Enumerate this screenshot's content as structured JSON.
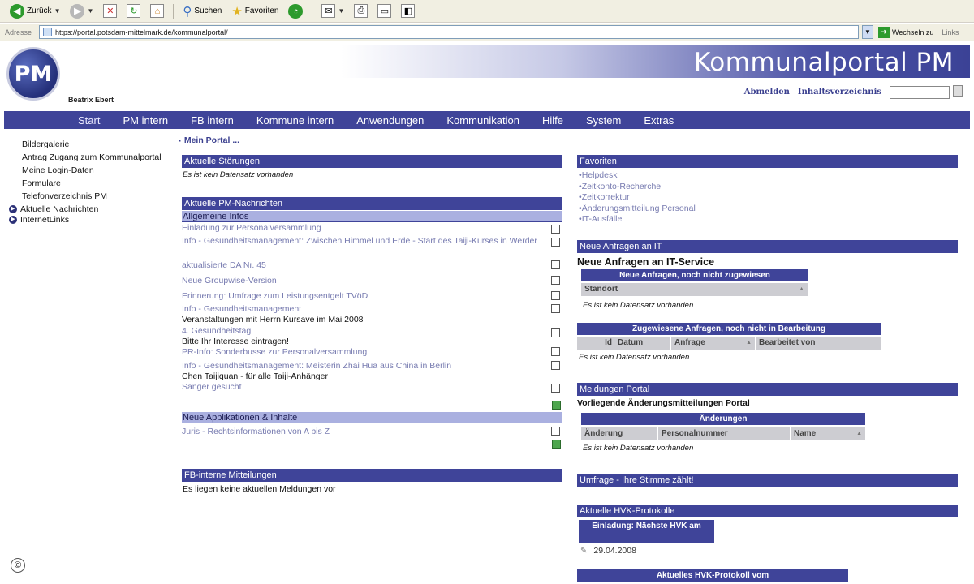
{
  "browser": {
    "back_label": "Zurück",
    "search_label": "Suchen",
    "favorites_label": "Favoriten",
    "address_label": "Adresse",
    "url": "https://portal.potsdam-mittelmark.de/kommunalportal/",
    "go_label": "Wechseln zu",
    "links_label": "Links"
  },
  "header": {
    "logo_text": "PM",
    "user_name": "Beatrix Ebert",
    "portal_title": "Kommunalportal PM",
    "logout_label": "Abmelden",
    "index_label": "Inhaltsverzeichnis"
  },
  "nav": [
    "Start",
    "PM intern",
    "FB intern",
    "Kommune intern",
    "Anwendungen",
    "Kommunikation",
    "Hilfe",
    "System",
    "Extras"
  ],
  "sidebar": {
    "items": [
      "Bildergalerie",
      "Antrag Zugang zum Kommunalportal",
      "Meine Login-Daten",
      "Formulare",
      "Telefonverzeichnis PM"
    ],
    "bullet_items": [
      "Aktuelle Nachrichten",
      "InternetLinks"
    ],
    "copyright": "©"
  },
  "crumb": "Mein Portal ...",
  "stoerungen": {
    "title": "Aktuelle Störungen",
    "note": "Es ist kein Datensatz vorhanden"
  },
  "nachrichten": {
    "title": "Aktuelle PM-Nachrichten",
    "sub_general": "Allgemeine Infos",
    "items": [
      {
        "text": "Einladung zur Personalversammlung",
        "extra": ""
      },
      {
        "text": "Info - Gesundheitsmanagement: Zwischen Himmel und Erde - Start des Taiji-Kurses in Werder",
        "extra": ""
      },
      {
        "text": "aktualisierte DA Nr. 45",
        "extra": ""
      },
      {
        "text": "Neue Groupwise-Version",
        "extra": ""
      },
      {
        "text": "Erinnerung: Umfrage zum Leistungsentgelt TVöD",
        "extra": ""
      },
      {
        "text": "Info - Gesundheitsmanagement",
        "extra": "Veranstaltungen mit Herrn Kursave im Mai 2008"
      },
      {
        "text": "4. Gesundheitstag",
        "extra": "Bitte Ihr Interesse eintragen!"
      },
      {
        "text": "PR-Info: Sonderbusse zur Personalversammlung",
        "extra": ""
      },
      {
        "text": "Info - Gesundheitsmanagement: Meisterin Zhai Hua aus China in Berlin",
        "extra": "Chen Taijiquan - für alle Taiji-Anhänger"
      },
      {
        "text": "Sänger gesucht",
        "extra": ""
      }
    ],
    "sub_apps": "Neue Applikationen & Inhalte",
    "app_items": [
      "Juris - Rechtsinformationen von A bis Z"
    ]
  },
  "fb_mitteilungen": {
    "title": "FB-interne Mitteilungen",
    "note": "Es liegen keine aktuellen Meldungen vor"
  },
  "favoriten": {
    "title": "Favoriten",
    "items": [
      "Helpdesk",
      "Zeitkonto-Recherche",
      "Zeitkorrektur",
      "Änderungsmitteilung Personal",
      "IT-Ausfälle"
    ]
  },
  "anfragen": {
    "title": "Neue Anfragen an IT",
    "heading": "Neue Anfragen an IT-Service",
    "table1_title": "Neue Anfragen, noch nicht zugewiesen",
    "table1_col": "Standort",
    "table1_note": "Es ist kein Datensatz vorhanden",
    "table2_title": "Zugewiesene Anfragen, noch nicht in Bearbeitung",
    "table2_cols": [
      "Id",
      "Datum",
      "Anfrage",
      "Bearbeitet von"
    ],
    "table2_note": "Es ist kein Datensatz vorhanden"
  },
  "meldungen": {
    "title": "Meldungen Portal",
    "heading": "Vorliegende Änderungsmitteilungen Portal",
    "table_title": "Änderungen",
    "cols": [
      "Änderung",
      "Personalnummer",
      "Name"
    ],
    "note": "Es ist kein Datensatz vorhanden"
  },
  "umfrage": {
    "title": "Umfrage - Ihre Stimme zählt!"
  },
  "hvk": {
    "title": "Aktuelle HVK-Protokolle",
    "invite": "Einladung: Nächste HVK am",
    "date": "29.04.2008",
    "protocol": "Aktuelles HVK-Protokoll vom"
  },
  "colors": {
    "nav_bg": "#3f4499",
    "subbar_bg": "#aab0e0",
    "link": "#777bb0"
  }
}
